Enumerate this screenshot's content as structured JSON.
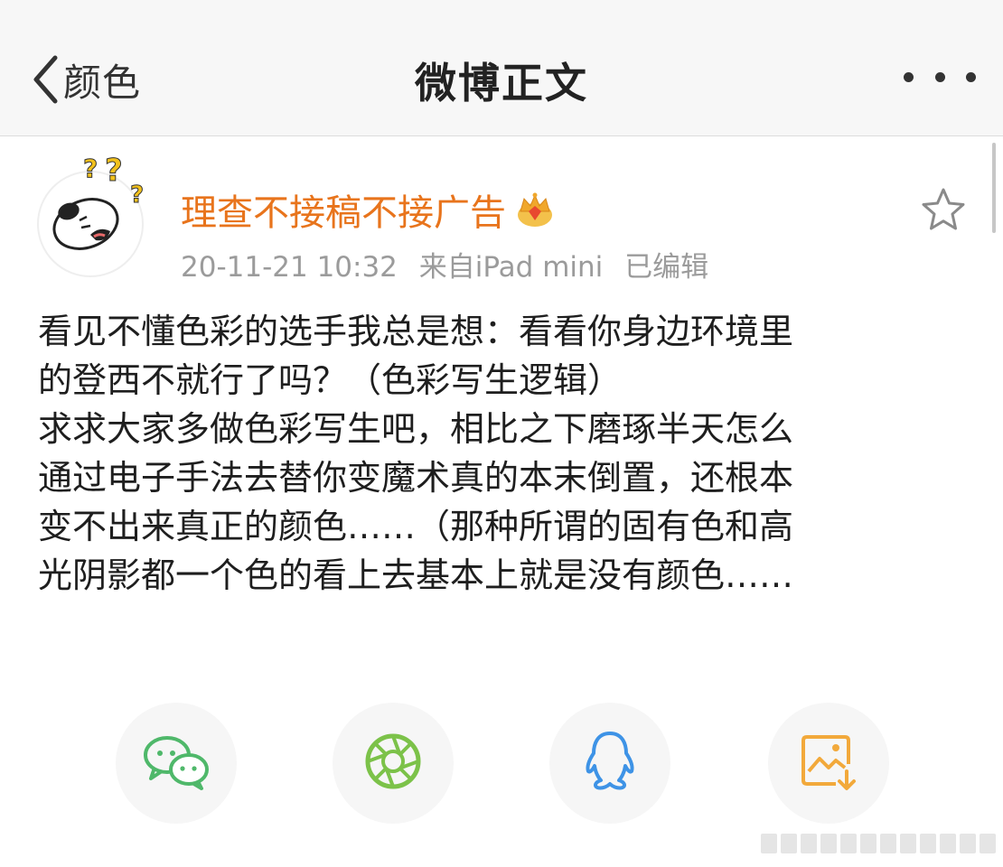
{
  "nav": {
    "back_label": "颜色",
    "title": "微博正文"
  },
  "post": {
    "username": "理查不接稿不接广告",
    "timestamp": "20-11-21 10:32",
    "source": "来自iPad mini",
    "edited": "已编辑",
    "lines": [
      "看见不懂色彩的选手我总是想：看看你身边环境里",
      "的登西不就行了吗？（色彩写生逻辑）",
      "求求大家多做色彩写生吧，相比之下磨琢半天怎么",
      "通过电子手法去替你变魔术真的本末倒置，还根本",
      "变不出来真正的颜色……（那种所谓的固有色和高",
      "光阴影都一个色的看上去基本上就是没有颜色……"
    ]
  },
  "share": {
    "buttons": [
      {
        "icon": "wechat-icon",
        "color": "#4fb86a"
      },
      {
        "icon": "moments-icon",
        "color": "#7cc249"
      },
      {
        "icon": "qq-icon",
        "color": "#3e93e6"
      },
      {
        "icon": "save-image-icon",
        "color": "#f2a93b"
      }
    ]
  },
  "colors": {
    "username": "#e8741c",
    "meta": "#9b9b9b",
    "navbar_bg": "#f7f7f7"
  }
}
